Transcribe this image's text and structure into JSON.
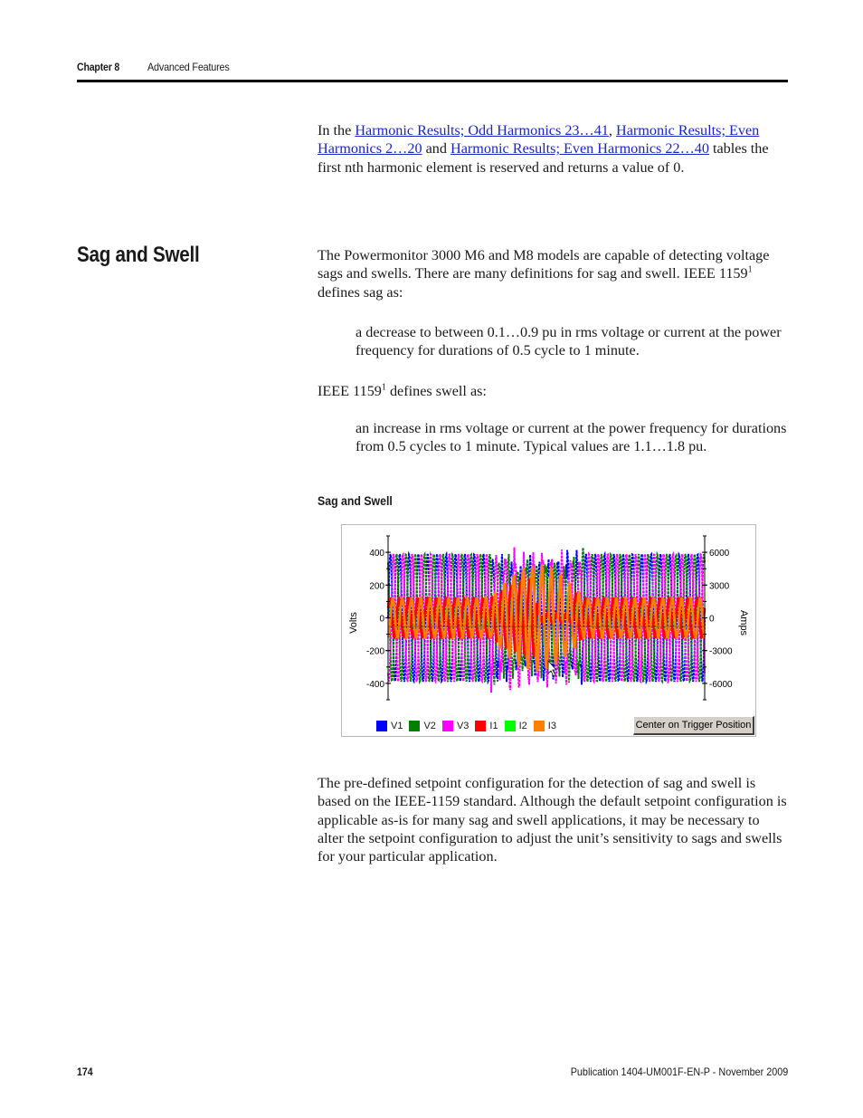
{
  "header": {
    "chapter": "Chapter 8",
    "title": "Advanced Features"
  },
  "intro": {
    "prefix": "In the ",
    "link1": "Harmonic Results; Odd Harmonics 23…41",
    "sep1": ", ",
    "link2": "Harmonic Results; Even Harmonics 2…20",
    "sep2": " and ",
    "link3": "Harmonic Results; Even Harmonics 22…40",
    "suffix": " tables the first nth harmonic element is reserved and returns a value of 0."
  },
  "section": {
    "heading": "Sag and Swell",
    "para1_a": "The Powermonitor 3000 M6 and M8 models are capable of detecting voltage sags and swells. There are many definitions for sag and swell. IEEE 1159",
    "para1_sup": "1",
    "para1_b": " defines sag as:",
    "sag_def": "a decrease to between 0.1…0.9 pu in rms voltage or current at the power frequency for durations of 0.5 cycle to 1 minute.",
    "para2_a": "IEEE 1159",
    "para2_sup": "1",
    "para2_b": " defines swell as:",
    "swell_def": "an increase in rms voltage or current at the power frequency for durations from 0.5 cycles to 1 minute. Typical values are 1.1…1.8 pu.",
    "figure_caption": "Sag and Swell",
    "para3": "The pre-defined setpoint configuration for the detection of sag and swell is based on the IEEE-1159 standard. Although the default setpoint configuration is applicable as-is for many sag and swell applications, it may be necessary to alter the setpoint configuration to adjust the unit’s sensitivity to sags and swells for your particular application."
  },
  "chart_data": {
    "type": "line",
    "title": "",
    "xlabel": "",
    "ylabel": "Volts",
    "y2label": "Amps",
    "ylim": [
      -500,
      500
    ],
    "y2lim": [
      -7500,
      7500
    ],
    "yticks": [
      "400",
      "200",
      "0",
      "-200",
      "-400"
    ],
    "y2ticks": [
      "6000",
      "3000",
      "0",
      "-3000",
      "-6000"
    ],
    "grid": false,
    "legend_position": "bottom-left",
    "cycles_visible": 34,
    "event_window_cycles": [
      11,
      21
    ],
    "series": [
      {
        "name": "V1",
        "color": "#0000ff",
        "axis": "left",
        "nominal_peak": 390,
        "phase_deg": 0,
        "event_peak": 350
      },
      {
        "name": "V2",
        "color": "#007f00",
        "axis": "left",
        "nominal_peak": 390,
        "phase_deg": 120,
        "event_peak": 330
      },
      {
        "name": "V3",
        "color": "#ff00ff",
        "axis": "left",
        "nominal_peak": 390,
        "phase_deg": 240,
        "event_peak": 400
      },
      {
        "name": "I1",
        "color": "#ff0000",
        "axis": "right",
        "nominal_peak": 1800,
        "phase_deg": 30,
        "event_peak": 3500
      },
      {
        "name": "I2",
        "color": "#00ff00",
        "axis": "right",
        "nominal_peak": 0,
        "phase_deg": 150,
        "event_peak": 0
      },
      {
        "name": "I3",
        "color": "#ff8000",
        "axis": "right",
        "nominal_peak": 1800,
        "phase_deg": 270,
        "event_peak": 4800
      }
    ]
  },
  "figure": {
    "button_label": "Center on Trigger Position"
  },
  "footer": {
    "page_number": "174",
    "publication": "Publication 1404-UM001F-EN-P - November 2009"
  }
}
